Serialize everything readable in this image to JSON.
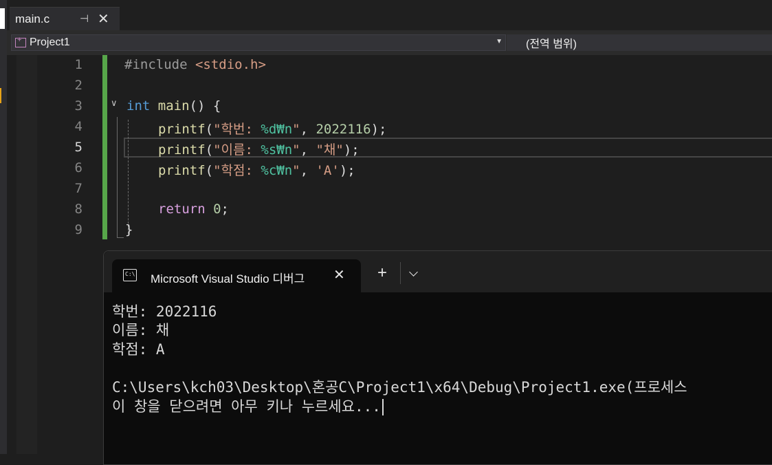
{
  "editor_tab": {
    "title": "main.c",
    "pin_glyph": "⊣",
    "close_glyph": "✕"
  },
  "navbar": {
    "project": "Project1",
    "scope": "(전역 범위)"
  },
  "code": {
    "line_numbers": [
      "1",
      "2",
      "3",
      "4",
      "5",
      "6",
      "7",
      "8",
      "9"
    ],
    "current_line": 5,
    "lines": [
      {
        "include_kw": "#include",
        "include_file": "<stdio.h>"
      },
      {},
      {
        "type": "int",
        "name": "main",
        "rest": "() {"
      },
      {
        "fn": "printf",
        "open": "(",
        "str_a": "\"학번: ",
        "fmt": "%d₩n",
        "str_b": "\"",
        "mid": ", ",
        "arg": "2022116",
        "close": ");"
      },
      {
        "fn": "printf",
        "open": "(",
        "str_a": "\"이름: ",
        "fmt": "%s₩n",
        "str_b": "\"",
        "mid": ", ",
        "arg": "\"채\"",
        "close": ");"
      },
      {
        "fn": "printf",
        "open": "(",
        "str_a": "\"학점: ",
        "fmt": "%c₩n",
        "str_b": "\"",
        "mid": ", ",
        "arg": "'A'",
        "close": ");"
      },
      {},
      {
        "kw": "return",
        "value": "0",
        "close": ";"
      },
      {
        "text": "}"
      }
    ]
  },
  "terminal": {
    "tab_title": "Microsoft Visual Studio 디버그",
    "icon_text": "C:\\",
    "close_glyph": "✕",
    "new_tab_glyph": "+",
    "output": [
      "학번: 2022116",
      "이름: 채",
      "학점: A",
      "",
      "C:\\Users\\kch03\\Desktop\\혼공C\\Project1\\x64\\Debug\\Project1.exe(프로세스",
      "이 창을 닫으려면 아무 키나 누르세요..."
    ]
  }
}
